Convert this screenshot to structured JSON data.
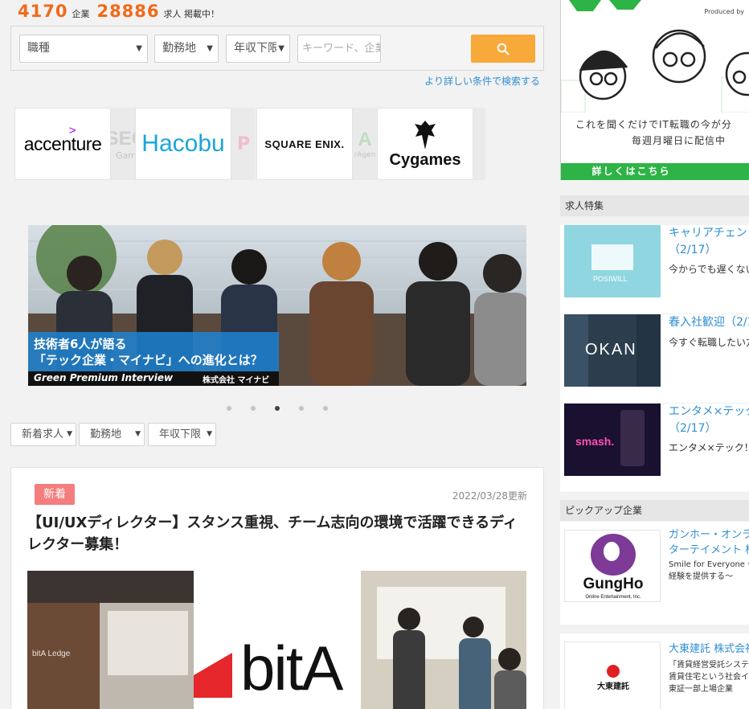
{
  "header": {
    "company_count": "4170",
    "company_unit": "企業",
    "job_count": "28886",
    "job_unit": "求人 掲載中！"
  },
  "search": {
    "occupation": "職種",
    "location": "勤務地",
    "salary": "年収下限",
    "keyword_placeholder": "キーワード、企業名",
    "advanced_link": "より詳しい条件で検索する"
  },
  "logos": {
    "accenture": "accenture",
    "hacobu": "Hacobu",
    "square_enix": "SQUARE ENIX.",
    "cygames": "Cygames",
    "ghost_1": "SEG",
    "ghost_1b": "Gam",
    "ghost_2": "A",
    "ghost_2b": "rAgen"
  },
  "banner": {
    "line1": "技術者6人が語る",
    "line2": "「テック企業・マイナビ」への進化とは？",
    "series": "Green Premium Interview",
    "company": "株式会社 マイナビ",
    "active_slide": 3,
    "slide_count": 5
  },
  "filters": {
    "sort": "新着求人",
    "location": "勤務地",
    "salary": "年収下限"
  },
  "job_card": {
    "badge": "新着",
    "updated": "2022/03/28更新",
    "title": "【UI/UXディレクター】スタンス重視、チーム志向の環境で活躍できるディレクター募集！",
    "logo_text": "bitA",
    "office_sign": "bitA  Ledge"
  },
  "ad": {
    "produced_by": "Produced by",
    "line1": "これを聞くだけでIT転職の今が分",
    "line2": "毎週月曜日に配信中",
    "cta": "詳しくはこちら",
    "accent": "#2eb346"
  },
  "features": {
    "heading": "求人特集",
    "items": [
      {
        "title": "キャリアチェン",
        "date": "（2/17）",
        "desc": "今からでも遅くない",
        "thumb": "POSIWILL"
      },
      {
        "title": "春入社歓迎（2/1",
        "date": "",
        "desc": "今すぐ転職したい方",
        "thumb": "OKAN"
      },
      {
        "title": "エンタメ×テック",
        "date": "（2/17）",
        "desc": "エンタメ×テック！",
        "thumb": "smash."
      }
    ]
  },
  "pickup": {
    "heading": "ピックアップ企業",
    "items": [
      {
        "title": "ガンホー・オンライ",
        "title2": "ターテイメント 株",
        "desc1": "Smile for Everyone 〜",
        "desc2": "経験を提供する〜",
        "logo": "GungHo",
        "logo_sub": "Online Entertainment, Inc."
      },
      {
        "title": "大東建託 株式会社",
        "desc1": "「賃貸経営受託システ",
        "desc2": "賃貸住宅という社会イ",
        "desc3": "東証一部上場企業",
        "logo": "大東建託"
      }
    ]
  }
}
